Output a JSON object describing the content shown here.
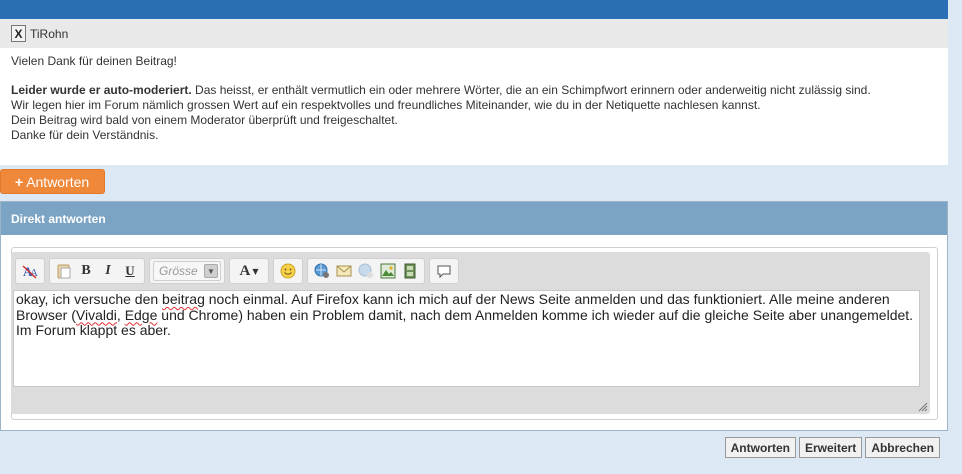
{
  "post": {
    "close_label": "X",
    "username": "TiRohn",
    "line1": "Vielen Dank für deinen Beitrag!",
    "bold_lead": "Leider wurde er auto-moderiert.",
    "line2_rest": " Das heisst, er enthält vermutlich ein oder mehrere Wörter, die an ein Schimpfwort erinnern oder anderweitig nicht zulässig sind.",
    "line3": "Wir legen hier im Forum nämlich grossen Wert auf ein respektvolles und freundliches Miteinander, wie du in der Netiquette nachlesen kannst.",
    "line4": "Dein Beitrag wird bald von einem Moderator überprüft und freigeschaltet.",
    "line5": "Danke für dein Verständnis."
  },
  "reply_button": {
    "plus": "+",
    "label": "Antworten"
  },
  "panel": {
    "title": "Direkt antworten"
  },
  "toolbar": {
    "size_placeholder": "Grösse",
    "bold": "B",
    "italic": "I",
    "underline": "U",
    "font": "A"
  },
  "editor": {
    "t1": "okay, ich versuche den ",
    "t2": "beitrag",
    "t3": " noch einmal. Auf Firefox kann ich mich auf der News Seite anmelden und das funktioniert. Alle meine anderen Browser (",
    "t4": "Vivaldi",
    "t5": ", ",
    "t6": "Edge",
    "t7": " und Chrome) haben ein Problem damit, nach dem Anmelden komme ich wieder auf die gleiche Seite aber unangemeldet. Im Forum klappt es aber."
  },
  "footer": {
    "submit": "Antworten",
    "advanced": "Erweitert",
    "cancel": "Abbrechen"
  },
  "colors": {
    "topbar": "#2a6fb4",
    "panel_header": "#7ba3c4",
    "reply_button": "#f0883a"
  }
}
